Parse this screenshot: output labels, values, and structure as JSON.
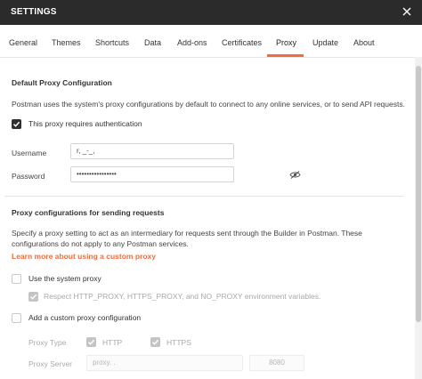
{
  "header": {
    "title": "SETTINGS"
  },
  "tabs": [
    {
      "label": "General"
    },
    {
      "label": "Themes"
    },
    {
      "label": "Shortcuts"
    },
    {
      "label": "Data"
    },
    {
      "label": "Add-ons"
    },
    {
      "label": "Certificates"
    },
    {
      "label": "Proxy",
      "active": true
    },
    {
      "label": "Update"
    },
    {
      "label": "About"
    }
  ],
  "default_proxy": {
    "title": "Default Proxy Configuration",
    "description": "Postman uses the system's proxy configurations by default to connect to any online services, or to send API requests.",
    "auth_checkbox_label": "This proxy requires authentication",
    "auth_checked": true,
    "username_label": "Username",
    "username_value": "r,  _-_,",
    "password_label": "Password",
    "password_value": "••••••••••••••••"
  },
  "request_proxy": {
    "title": "Proxy configurations for sending requests",
    "description": "Specify a proxy setting to act as an intermediary for requests sent through the Builder in Postman. These configurations do not apply to any Postman services.",
    "learn_more": "Learn more about using a custom proxy",
    "use_system_label": "Use the system proxy",
    "use_system_checked": false,
    "respect_env_label": "Respect HTTP_PROXY, HTTPS_PROXY, and NO_PROXY environment variables.",
    "respect_env_checked": true,
    "custom_label": "Add a custom proxy configuration",
    "custom_checked": false,
    "proxy_type_label": "Proxy Type",
    "http_label": "HTTP",
    "https_label": "HTTPS",
    "proxy_server_label": "Proxy Server",
    "proxy_server_value": "proxy.  .",
    "proxy_port_value": "8080"
  },
  "colors": {
    "accent": "#f26b3a",
    "header_bg": "#2b2b2b"
  },
  "icons": {
    "close": "close-icon",
    "eye": "eye-slash-icon",
    "check": "check-icon"
  }
}
